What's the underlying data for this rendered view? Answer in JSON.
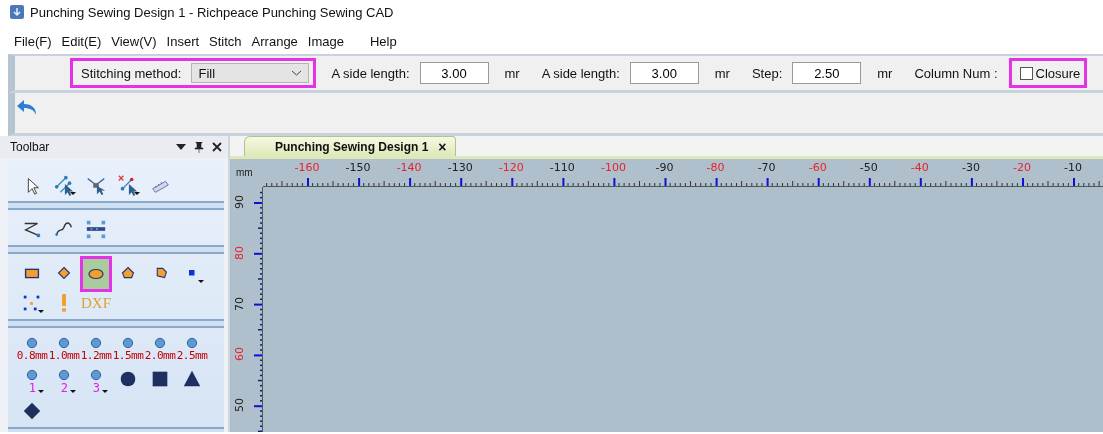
{
  "window": {
    "title": "Punching Sewing Design 1 - Richpeace Punching Sewing CAD"
  },
  "menu": [
    "File(F)",
    "Edit(E)",
    "View(V)",
    "Insert",
    "Stitch",
    "Arrange",
    "Image",
    "Help"
  ],
  "property_bar": {
    "items": [
      {
        "kind": "select",
        "label": "Stitching method:",
        "value": "Fill",
        "highlighted": true
      },
      {
        "kind": "number",
        "label": "A side length:",
        "value": "3.00",
        "unit": "mr",
        "highlighted": false
      },
      {
        "kind": "number",
        "label": "A side length:",
        "value": "3.00",
        "unit": "mr",
        "highlighted": false
      },
      {
        "kind": "number",
        "label": "Step:",
        "value": "2.50",
        "unit": "mr",
        "highlighted": false
      },
      {
        "kind": "label",
        "label": "Column Num :",
        "highlighted": false
      },
      {
        "kind": "checkbox",
        "label": "Closure",
        "checked": false,
        "highlighted": true
      }
    ]
  },
  "tool_panel": {
    "title": "Toolbar",
    "groups": [
      [
        {
          "kind": "pointer",
          "selected": false,
          "dropdown": false
        },
        {
          "kind": "node-edit",
          "selected": false,
          "dropdown": true
        },
        {
          "kind": "cut",
          "selected": false,
          "dropdown": false
        },
        {
          "kind": "node-delete",
          "selected": false,
          "dropdown": true
        },
        {
          "kind": "measure",
          "selected": false,
          "dropdown": false
        }
      ],
      [
        {
          "kind": "polyline",
          "selected": false,
          "dropdown": false
        },
        {
          "kind": "curve",
          "selected": false,
          "dropdown": false
        },
        {
          "kind": "grid-points",
          "selected": false,
          "dropdown": false
        }
      ],
      [
        {
          "kind": "rect",
          "selected": false,
          "dropdown": false
        },
        {
          "kind": "diamond",
          "selected": false,
          "dropdown": false
        },
        {
          "kind": "ellipse",
          "selected": true,
          "dropdown": false
        },
        {
          "kind": "pentagon",
          "selected": false,
          "dropdown": false
        },
        {
          "kind": "polygon",
          "selected": false,
          "dropdown": false
        },
        {
          "kind": "point",
          "selected": false,
          "dropdown": true
        },
        {
          "kind": "scatter",
          "selected": false,
          "dropdown": true
        },
        {
          "kind": "warning",
          "selected": false,
          "dropdown": false
        },
        {
          "kind": "text",
          "label": "DXF",
          "selected": false,
          "dropdown": false
        }
      ],
      [
        {
          "kind": "circle-size",
          "label": "0.8mm",
          "selected": false,
          "dropdown": false
        },
        {
          "kind": "circle-size",
          "label": "1.0mm",
          "selected": false,
          "dropdown": false
        },
        {
          "kind": "circle-size",
          "label": "1.2mm",
          "selected": false,
          "dropdown": false
        },
        {
          "kind": "circle-size",
          "label": "1.5mm",
          "selected": false,
          "dropdown": false
        },
        {
          "kind": "circle-size",
          "label": "2.0mm",
          "selected": false,
          "dropdown": false
        },
        {
          "kind": "circle-size",
          "label": "2.5mm",
          "selected": false,
          "dropdown": false
        },
        {
          "kind": "circle-number",
          "label": "1",
          "selected": false,
          "dropdown": true
        },
        {
          "kind": "circle-number",
          "label": "2",
          "selected": false,
          "dropdown": true
        },
        {
          "kind": "circle-number",
          "label": "3",
          "selected": false,
          "dropdown": true
        },
        {
          "kind": "dot",
          "selected": false,
          "dropdown": false
        },
        {
          "kind": "square",
          "selected": false,
          "dropdown": false
        },
        {
          "kind": "triangle",
          "selected": false,
          "dropdown": false
        },
        {
          "kind": "diamond-fill",
          "selected": false,
          "dropdown": false
        }
      ]
    ]
  },
  "document": {
    "tabs": [
      {
        "label": "Punching Sewing Design 1",
        "close": "×",
        "selected": true
      }
    ],
    "ruler_unit": "mm",
    "x_ruler": [
      {
        "label": "-160",
        "color": "#e8202a"
      },
      {
        "label": "-150",
        "color": "#202020"
      },
      {
        "label": "-140",
        "color": "#e8202a"
      },
      {
        "label": "-130",
        "color": "#202020"
      },
      {
        "label": "-120",
        "color": "#e8202a"
      },
      {
        "label": "-110",
        "color": "#202020"
      },
      {
        "label": "-100",
        "color": "#e8202a"
      },
      {
        "label": "-90",
        "color": "#202020"
      },
      {
        "label": "-80",
        "color": "#e8202a"
      },
      {
        "label": "-70",
        "color": "#202020"
      },
      {
        "label": "-60",
        "color": "#e8202a"
      },
      {
        "label": "-50",
        "color": "#202020"
      },
      {
        "label": "-40",
        "color": "#e8202a"
      },
      {
        "label": "-30",
        "color": "#202020"
      },
      {
        "label": "-20",
        "color": "#e8202a"
      },
      {
        "label": "-10",
        "color": "#202020"
      }
    ],
    "y_ruler": [
      {
        "label": "90",
        "color": "#202020"
      },
      {
        "label": "80",
        "color": "#e8202a"
      },
      {
        "label": "70",
        "color": "#202020"
      },
      {
        "label": "60",
        "color": "#e8202a"
      },
      {
        "label": "50",
        "color": "#202020"
      }
    ]
  }
}
